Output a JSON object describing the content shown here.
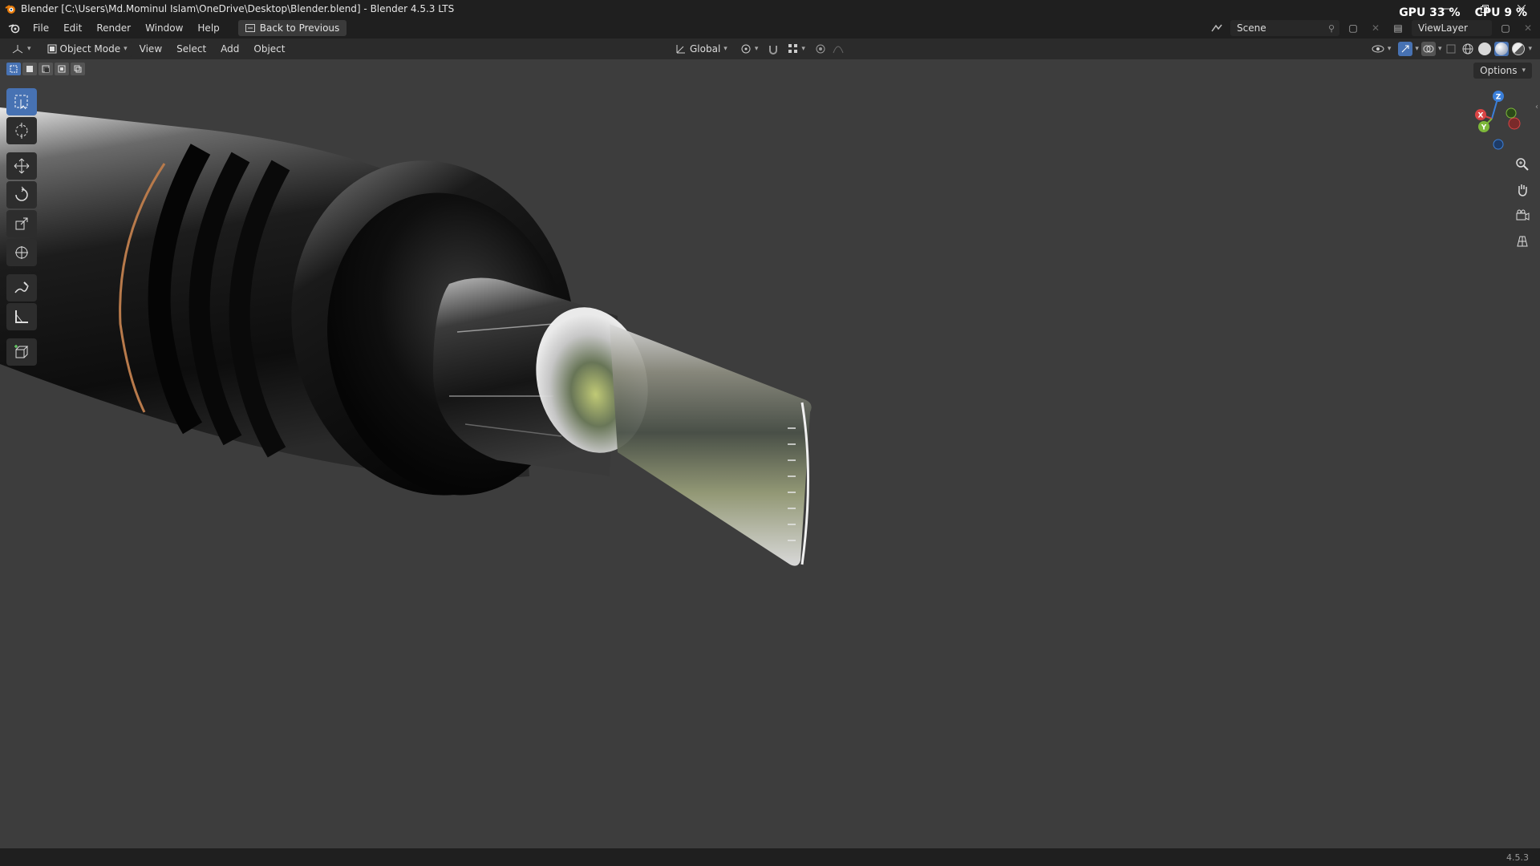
{
  "window": {
    "title": "Blender [C:\\Users\\Md.Mominul Islam\\OneDrive\\Desktop\\Blender.blend] - Blender 4.5.3 LTS",
    "controls": [
      "minimize",
      "restore",
      "close"
    ]
  },
  "stats": {
    "gpu": "GPU 33 %",
    "cpu": "CPU 9 %"
  },
  "menubar": {
    "items": [
      "File",
      "Edit",
      "Render",
      "Window",
      "Help"
    ],
    "back_label": "Back to Previous",
    "scene_label": "Scene",
    "view_layer_label": "ViewLayer"
  },
  "viewport_header": {
    "mode": "Object Mode",
    "menus": [
      "View",
      "Select",
      "Add",
      "Object"
    ],
    "orientation": "Global"
  },
  "viewport": {
    "options_label": "Options",
    "gizmo_axes": [
      "X",
      "Y",
      "Z"
    ],
    "accent": "#4772b3"
  },
  "statusbar": {
    "version": "4.5.3"
  }
}
